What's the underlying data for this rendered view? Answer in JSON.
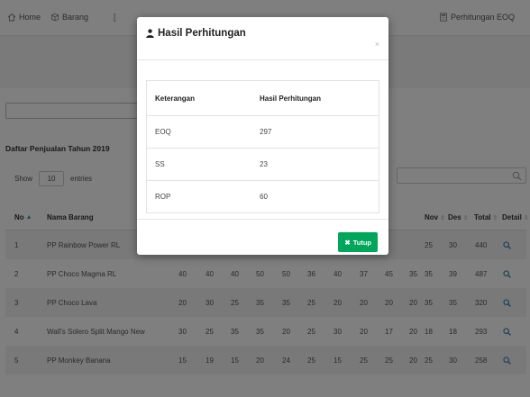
{
  "navbar": {
    "items": [
      {
        "label": "Home",
        "icon": "home-icon"
      },
      {
        "label": "Barang",
        "icon": "box-icon"
      },
      {
        "label": "Perhitungan EOQ",
        "icon": "calculator-icon"
      }
    ]
  },
  "section": {
    "title": "Daftar Penjualan Tahun 2019"
  },
  "datatable": {
    "show_label": "Show",
    "length_value": "10",
    "entries_label": "entries",
    "columns": {
      "no": "No",
      "nama": "Nama Barang",
      "nov": "Nov",
      "des": "Des",
      "total": "Total",
      "detail": "Detail"
    },
    "rows": [
      {
        "no": "1",
        "nama": "PP Rainbow Power RL",
        "m": [
          "",
          "",
          "",
          "",
          "",
          "",
          "",
          "",
          "",
          ""
        ],
        "nov": "25",
        "des": "30",
        "total": "440"
      },
      {
        "no": "2",
        "nama": "PP Choco Magma RL",
        "m": [
          "40",
          "40",
          "40",
          "50",
          "50",
          "36",
          "40",
          "37",
          "45",
          "35"
        ],
        "nov": "35",
        "des": "39",
        "total": "487"
      },
      {
        "no": "3",
        "nama": "PP Choco Lava",
        "m": [
          "20",
          "30",
          "25",
          "35",
          "35",
          "25",
          "20",
          "20",
          "20",
          "20"
        ],
        "nov": "35",
        "des": "35",
        "total": "320"
      },
      {
        "no": "4",
        "nama": "Wall's Solero Split Mango New",
        "m": [
          "30",
          "25",
          "35",
          "35",
          "20",
          "25",
          "30",
          "20",
          "17",
          "20"
        ],
        "nov": "18",
        "des": "18",
        "total": "293"
      },
      {
        "no": "5",
        "nama": "PP Monkey Banana",
        "m": [
          "15",
          "19",
          "15",
          "20",
          "24",
          "25",
          "15",
          "25",
          "25",
          "20"
        ],
        "nov": "25",
        "des": "30",
        "total": "258"
      }
    ]
  },
  "modal": {
    "title": "Hasil Perhitungan",
    "close_symbol": "×",
    "header_keterangan": "Keterangan",
    "header_hasil": "Hasil Perhitungan",
    "results": [
      {
        "label": "EOQ",
        "value": "297"
      },
      {
        "label": "SS",
        "value": "23"
      },
      {
        "label": "ROP",
        "value": "60"
      }
    ],
    "button_label": "Tutup",
    "button_icon_symbol": "✖"
  },
  "colors": {
    "accent": "#3c8dbc",
    "success": "#00a65a"
  }
}
